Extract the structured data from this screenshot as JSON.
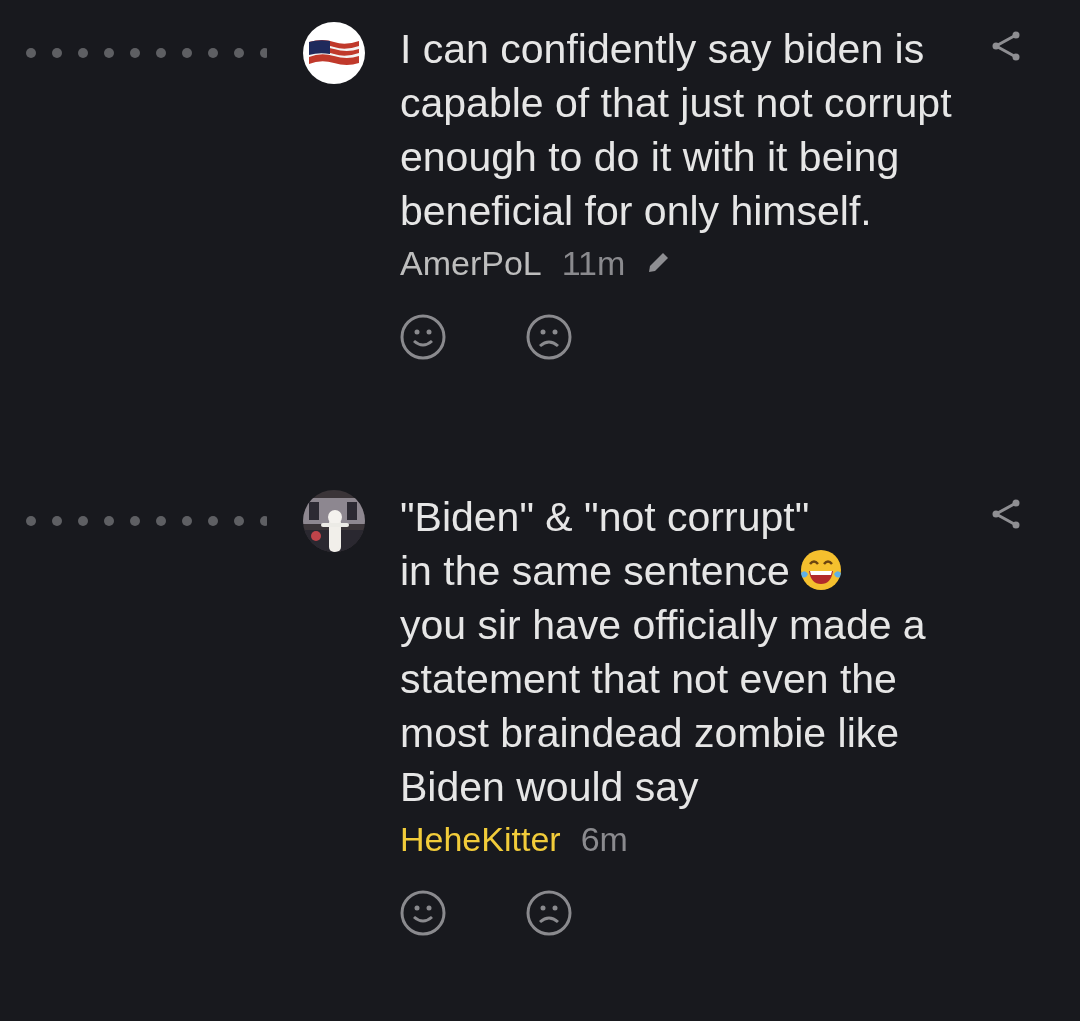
{
  "comments": [
    {
      "text": "I can confidently say biden is capable of that just not corrupt enough to do it with it being beneficial for only himself.",
      "author": {
        "name": "AmerPoL",
        "color": "#bdbdbd"
      },
      "time": "11m",
      "edited": true
    },
    {
      "text": "\"Biden\" & \"not corrupt\"\nin the same sentence",
      "emoji": true,
      "text_after": "you sir have officially made a statement that not even the most braindead zombie like Biden would say",
      "author": {
        "name": "HeheKitter",
        "color": "#f2cc3a"
      },
      "time": "6m"
    }
  ]
}
